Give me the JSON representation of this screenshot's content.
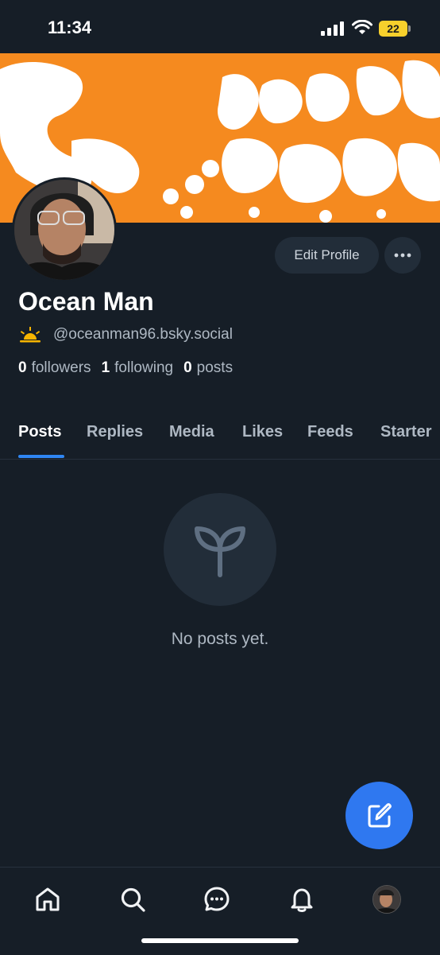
{
  "status_bar": {
    "time": "11:34",
    "battery": "22"
  },
  "profile": {
    "display_name": "Ocean Man",
    "handle": "@oceanman96.bsky.social",
    "stats": [
      {
        "count": "0",
        "label": "followers"
      },
      {
        "count": "1",
        "label": "following"
      },
      {
        "count": "0",
        "label": "posts"
      }
    ]
  },
  "actions": {
    "edit_profile": "Edit Profile"
  },
  "tabs": [
    "Posts",
    "Replies",
    "Media",
    "Likes",
    "Feeds",
    "Starter"
  ],
  "empty_state": {
    "message": "No posts yet."
  },
  "colors": {
    "accent": "#2f86f2",
    "banner": "#f58a1f",
    "background": "#161e27"
  },
  "icons": {
    "empty_state": "sprout-icon",
    "fab": "compose-icon",
    "nav": [
      "home-icon",
      "search-icon",
      "chat-icon",
      "bell-icon",
      "avatar"
    ]
  }
}
